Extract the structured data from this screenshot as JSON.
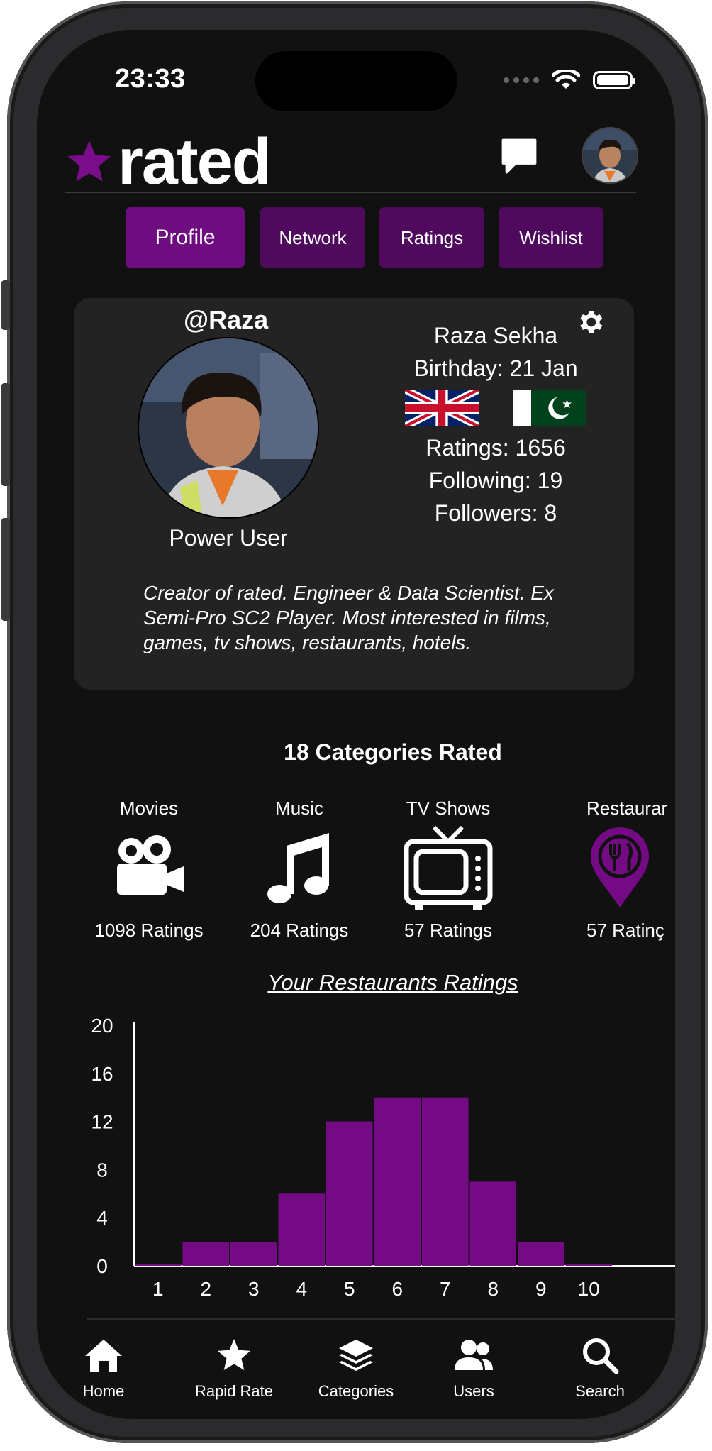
{
  "status": {
    "time": "23:33"
  },
  "header": {
    "brand": "rated"
  },
  "tabs": [
    "Profile",
    "Network",
    "Ratings",
    "Wishlist"
  ],
  "profile": {
    "handle": "@Raza",
    "level": "Power User",
    "name": "Raza Sekha",
    "birthday": "Birthday: 21 Jan",
    "ratings": "Ratings: 1656",
    "following": "Following: 19",
    "followers": "Followers: 8",
    "flags": [
      "uk-flag",
      "pakistan-flag"
    ],
    "bio": "Creator of rated. Engineer & Data Scientist. Ex Semi-Pro SC2 Player. Most interested in films, games, tv shows, restaurants, hotels."
  },
  "categories": {
    "title": "18 Categories Rated",
    "items": [
      {
        "name": "Movies",
        "count": "1098 Ratings",
        "icon": "movie-camera-icon"
      },
      {
        "name": "Music",
        "count": "204 Ratings",
        "icon": "music-note-icon"
      },
      {
        "name": "TV Shows",
        "count": "57 Ratings",
        "icon": "tv-icon"
      },
      {
        "name": "Restaurar",
        "count": "57 Ratinç",
        "icon": "restaurant-pin-icon"
      }
    ]
  },
  "chart_title": "Your Restaurants Ratings",
  "chart_data": {
    "type": "bar",
    "categories": [
      "1",
      "2",
      "3",
      "4",
      "5",
      "6",
      "7",
      "8",
      "9",
      "10"
    ],
    "values": [
      0,
      2,
      2,
      6,
      12,
      14,
      14,
      7,
      2,
      0
    ],
    "title": "Your Restaurants Ratings",
    "ylim": [
      0,
      20
    ],
    "yticks": [
      0,
      4,
      8,
      12,
      16,
      20
    ],
    "bar_color": "#750a85"
  },
  "nav": [
    {
      "label": "Home",
      "icon": "home-icon"
    },
    {
      "label": "Rapid Rate",
      "icon": "star-icon"
    },
    {
      "label": "Categories",
      "icon": "layers-icon"
    },
    {
      "label": "Users",
      "icon": "users-icon"
    },
    {
      "label": "Search",
      "icon": "search-icon"
    }
  ],
  "colors": {
    "accent": "#750a85",
    "tab": "#4f0a5e",
    "tab_active": "#6e0c80",
    "background": "#111112",
    "card": "#232323"
  }
}
